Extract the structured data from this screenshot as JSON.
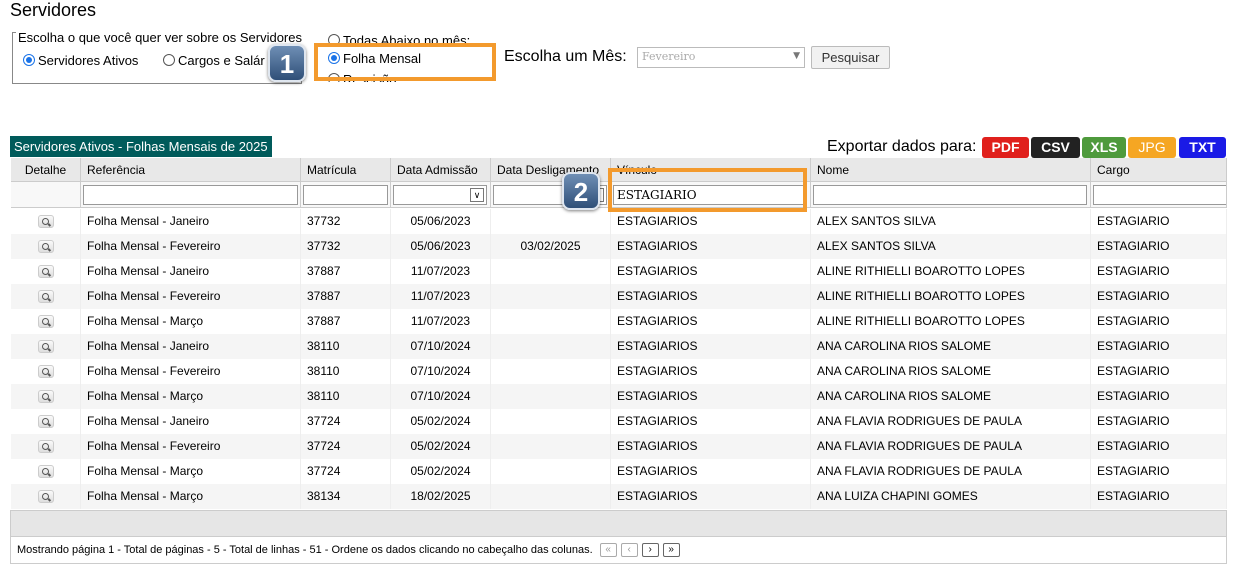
{
  "page": {
    "title": "Servidores"
  },
  "filters": {
    "group_label": "Escolha o que você quer ver sobre os Servidores",
    "option_active": "Servidores Ativos",
    "option_cargos": "Cargos e Salár",
    "option_todas": "Todas Abaixo no mês:",
    "option_folha": "Folha Mensal",
    "option_rescisao": "Rescisão",
    "month_label": "Escolha um Mês:",
    "month_value": "Fevereiro",
    "search_button": "Pesquisar"
  },
  "badges": {
    "one": "1",
    "two": "2"
  },
  "grid": {
    "caption": "Servidores Ativos - Folhas Mensais de 2025",
    "export_label": "Exportar dados para:",
    "export_buttons": [
      {
        "label": "PDF",
        "color": "#e0201c"
      },
      {
        "label": "CSV",
        "color": "#222222"
      },
      {
        "label": "XLS",
        "color": "#4e9a3c"
      },
      {
        "label": "JPG",
        "color": "#f5a623"
      },
      {
        "label": "TXT",
        "color": "#1a1ae6"
      }
    ],
    "columns": [
      "Detalhe",
      "Referência",
      "Matrícula",
      "Data Admissão",
      "Data Desligamento",
      "Vínculo",
      "Nome",
      "Cargo"
    ],
    "vinculo_filter": "ESTAGIARIO",
    "rows": [
      [
        "Folha Mensal - Janeiro",
        "37732",
        "05/06/2023",
        "",
        "ESTAGIARIOS",
        "ALEX SANTOS SILVA",
        "ESTAGIARIO"
      ],
      [
        "Folha Mensal - Fevereiro",
        "37732",
        "05/06/2023",
        "03/02/2025",
        "ESTAGIARIOS",
        "ALEX SANTOS SILVA",
        "ESTAGIARIO"
      ],
      [
        "Folha Mensal - Janeiro",
        "37887",
        "11/07/2023",
        "",
        "ESTAGIARIOS",
        "ALINE RITHIELLI BOAROTTO LOPES",
        "ESTAGIARIO"
      ],
      [
        "Folha Mensal - Fevereiro",
        "37887",
        "11/07/2023",
        "",
        "ESTAGIARIOS",
        "ALINE RITHIELLI BOAROTTO LOPES",
        "ESTAGIARIO"
      ],
      [
        "Folha Mensal - Março",
        "37887",
        "11/07/2023",
        "",
        "ESTAGIARIOS",
        "ALINE RITHIELLI BOAROTTO LOPES",
        "ESTAGIARIO"
      ],
      [
        "Folha Mensal - Janeiro",
        "38110",
        "07/10/2024",
        "",
        "ESTAGIARIOS",
        "ANA CAROLINA RIOS SALOME",
        "ESTAGIARIO"
      ],
      [
        "Folha Mensal - Fevereiro",
        "38110",
        "07/10/2024",
        "",
        "ESTAGIARIOS",
        "ANA CAROLINA RIOS SALOME",
        "ESTAGIARIO"
      ],
      [
        "Folha Mensal - Março",
        "38110",
        "07/10/2024",
        "",
        "ESTAGIARIOS",
        "ANA CAROLINA RIOS SALOME",
        "ESTAGIARIO"
      ],
      [
        "Folha Mensal - Janeiro",
        "37724",
        "05/02/2024",
        "",
        "ESTAGIARIOS",
        "ANA FLAVIA RODRIGUES DE PAULA",
        "ESTAGIARIO"
      ],
      [
        "Folha Mensal - Fevereiro",
        "37724",
        "05/02/2024",
        "",
        "ESTAGIARIOS",
        "ANA FLAVIA RODRIGUES DE PAULA",
        "ESTAGIARIO"
      ],
      [
        "Folha Mensal - Março",
        "37724",
        "05/02/2024",
        "",
        "ESTAGIARIOS",
        "ANA FLAVIA RODRIGUES DE PAULA",
        "ESTAGIARIO"
      ],
      [
        "Folha Mensal - Março",
        "38134",
        "18/02/2025",
        "",
        "ESTAGIARIOS",
        "ANA LUIZA CHAPINI GOMES",
        "ESTAGIARIO"
      ]
    ],
    "footer": "Mostrando página 1 - Total de páginas - 5 - Total de linhas - 51 - Ordene os dados clicando no cabeçalho das colunas.",
    "pager": [
      "«",
      "‹",
      "›",
      "»"
    ]
  }
}
